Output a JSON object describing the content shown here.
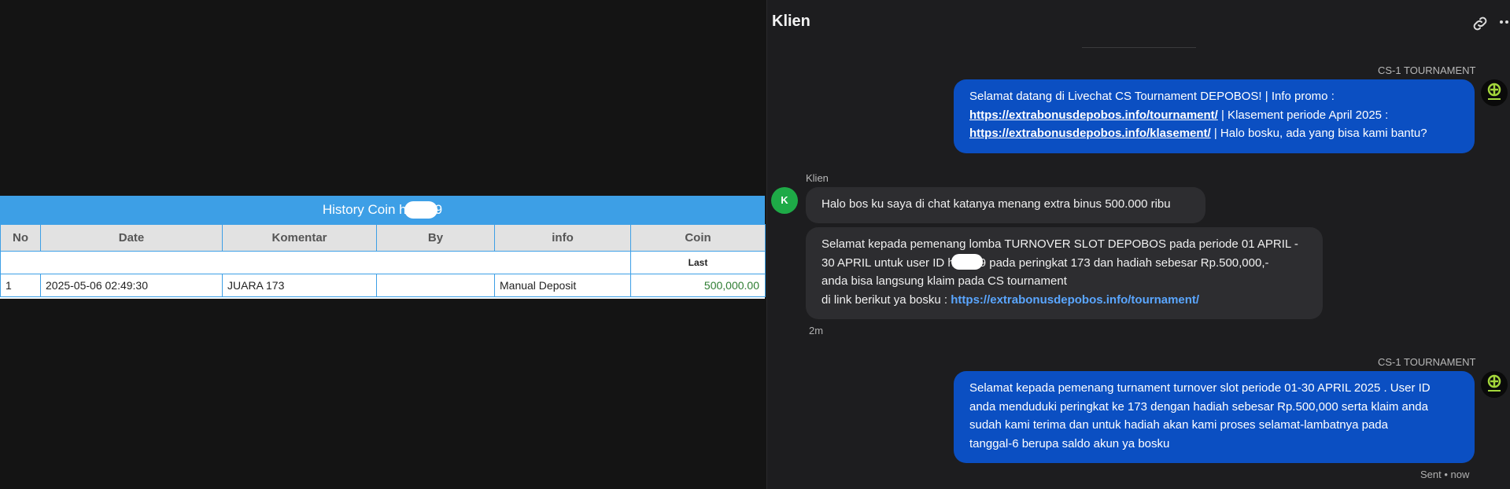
{
  "history": {
    "title_prefix": "History Coin h",
    "title_suffix": "9",
    "columns": [
      "No",
      "Date",
      "Komentar",
      "By",
      "info",
      "Coin"
    ],
    "subheader_coin": "Last",
    "rows": [
      {
        "no": "1",
        "date": "2025-05-06 02:49:30",
        "komentar": "JUARA 173",
        "by": "",
        "info": "Manual Deposit",
        "coin": "500,000.00"
      }
    ]
  },
  "chat": {
    "title": "Klien",
    "messages": [
      {
        "sender": "CS-1 TOURNAMENT",
        "line1": "Selamat datang di Livechat CS Tournament DEPOBOS! | Info promo :",
        "link1": "https://extrabonusdepobos.info/tournament/",
        "line2_suffix": " | Klasement periode April 2025 :",
        "link2": "https://extrabonusdepobos.info/klasement/",
        "line3_suffix": " | Halo bosku, ada yang bisa kami bantu?"
      },
      {
        "sender": "Klien",
        "avatar_letter": "K",
        "text": "Halo bos ku saya di chat katanya menang extra binus 500.000 ribu"
      },
      {
        "line1": "Selamat kepada pemenang lomba TURNOVER SLOT DEPOBOS pada periode 01 APRIL -",
        "line2_prefix": "30 APRIL untuk user ID h",
        "line2_suffix": "9 pada peringkat 173 dan hadiah sebesar Rp.500,000,-",
        "line3": "anda bisa langsung klaim pada CS tournament",
        "line4_prefix": "di link berikut ya bosku : ",
        "link": "https://extrabonusdepobos.info/tournament/",
        "time": "2m"
      },
      {
        "sender": "CS-1 TOURNAMENT",
        "line1": "Selamat kepada pemenang turnament turnover slot periode 01-30 APRIL 2025 . User ID",
        "line2": "anda menduduki peringkat ke 173 dengan hadiah sebesar Rp.500,000 serta klaim anda",
        "line3": "sudah kami terima dan untuk hadiah akan kami proses selamat-lambatnya pada",
        "line4": "tanggal-6 berupa saldo akun ya bosku",
        "status": "Sent • now"
      }
    ]
  },
  "icons": {
    "link": "link-icon",
    "more": "more-horizontal-icon",
    "agent_logo": "tournament-logo-icon"
  },
  "colors": {
    "table_header": "#3d9fe6",
    "bubble_out": "#0b4fc2",
    "bubble_in": "#2d2d30",
    "client_avatar": "#1eaa47",
    "coin_text": "#2e7d32",
    "link_in": "#5aa6ff"
  }
}
